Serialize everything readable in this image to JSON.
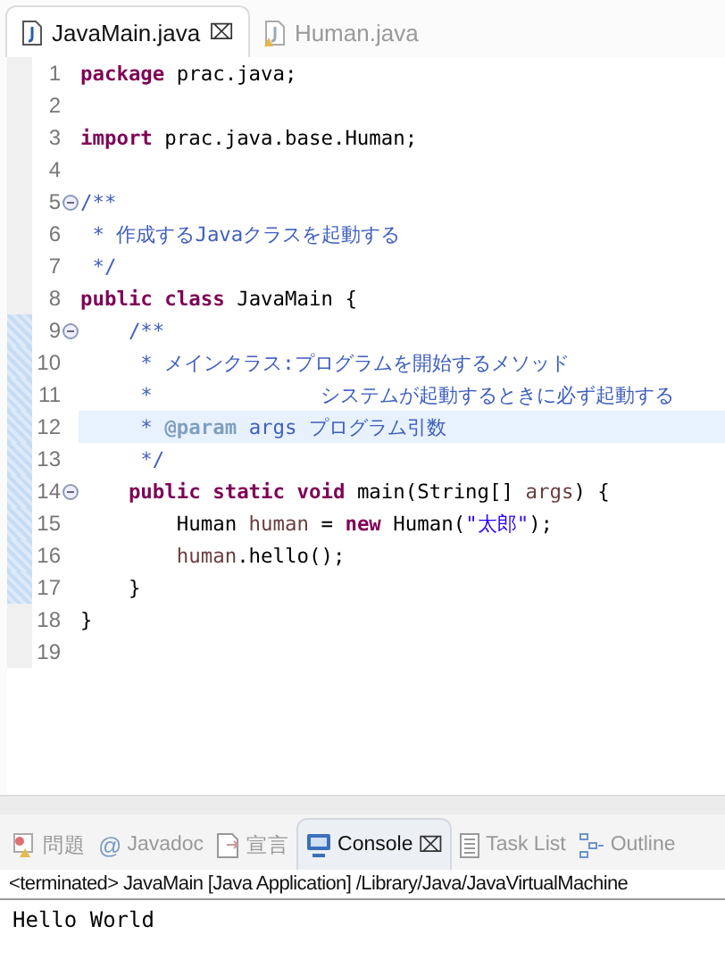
{
  "editor_tabs": [
    {
      "label": "JavaMain.java",
      "selected": true,
      "close": "⌧"
    },
    {
      "label": "Human.java",
      "selected": false
    }
  ],
  "code_lines": [
    {
      "number": "1",
      "fold": false,
      "current": false,
      "changed": false,
      "segments": [
        {
          "kind": "keyword",
          "text": "package"
        },
        {
          "kind": "plain",
          "text": " prac.java;"
        }
      ]
    },
    {
      "number": "2",
      "fold": false,
      "current": false,
      "changed": false
    },
    {
      "number": "3",
      "fold": false,
      "current": false,
      "changed": false,
      "segments": [
        {
          "kind": "keyword",
          "text": "import"
        },
        {
          "kind": "plain",
          "text": " prac.java.base.Human;"
        }
      ]
    },
    {
      "number": "4",
      "fold": false,
      "current": false,
      "changed": false
    },
    {
      "number": "5",
      "fold": true,
      "current": false,
      "changed": false,
      "segments": [
        {
          "kind": "comment",
          "text": "/**"
        }
      ]
    },
    {
      "number": "6",
      "fold": false,
      "current": false,
      "changed": false,
      "segments": [
        {
          "kind": "comment",
          "text": " * 作成するJavaクラスを起動する"
        }
      ]
    },
    {
      "number": "7",
      "fold": false,
      "current": false,
      "changed": false,
      "segments": [
        {
          "kind": "comment",
          "text": " */"
        }
      ]
    },
    {
      "number": "8",
      "fold": false,
      "current": false,
      "changed": false,
      "segments": [
        {
          "kind": "keyword",
          "text": "public "
        },
        {
          "kind": "keyword",
          "text": "class"
        },
        {
          "kind": "plain",
          "text": " JavaMain {"
        }
      ]
    },
    {
      "number": "9",
      "fold": true,
      "current": false,
      "changed": true,
      "segments": [
        {
          "kind": "comment",
          "text": "    /**"
        }
      ]
    },
    {
      "number": "10",
      "fold": false,
      "current": false,
      "changed": true,
      "segments": [
        {
          "kind": "comment",
          "text": "     * メインクラス:プログラムを開始するメソッド"
        }
      ]
    },
    {
      "number": "11",
      "fold": false,
      "current": false,
      "changed": true,
      "segments": [
        {
          "kind": "comment",
          "text": "     *              システムが起動するときに必ず起動する"
        }
      ]
    },
    {
      "number": "12",
      "fold": false,
      "current": true,
      "changed": true,
      "segments": [
        {
          "kind": "comment",
          "text": "     * "
        },
        {
          "kind": "doctag",
          "text": "@param"
        },
        {
          "kind": "comment",
          "text": " args プログラム引数"
        }
      ]
    },
    {
      "number": "13",
      "fold": false,
      "current": false,
      "changed": true,
      "segments": [
        {
          "kind": "comment",
          "text": "     */"
        }
      ]
    },
    {
      "number": "14",
      "fold": true,
      "current": false,
      "changed": true,
      "segments": [
        {
          "kind": "keyword",
          "text": "    public "
        },
        {
          "kind": "keyword",
          "text": "static "
        },
        {
          "kind": "keyword",
          "text": "void"
        },
        {
          "kind": "plain",
          "text": " main(String[] "
        },
        {
          "kind": "variable",
          "text": "args"
        },
        {
          "kind": "plain",
          "text": ") {"
        }
      ]
    },
    {
      "number": "15",
      "fold": false,
      "current": false,
      "changed": true,
      "segments": [
        {
          "kind": "plain",
          "text": "        Human "
        },
        {
          "kind": "variable",
          "text": "human"
        },
        {
          "kind": "plain",
          "text": " = "
        },
        {
          "kind": "keyword",
          "text": "new"
        },
        {
          "kind": "plain",
          "text": " Human("
        },
        {
          "kind": "string",
          "text": "\"太郎\""
        },
        {
          "kind": "plain",
          "text": ");"
        }
      ]
    },
    {
      "number": "16",
      "fold": false,
      "current": false,
      "changed": true,
      "segments": [
        {
          "kind": "variable",
          "text": "        human"
        },
        {
          "kind": "plain",
          "text": ".hello();"
        }
      ]
    },
    {
      "number": "17",
      "fold": false,
      "current": false,
      "changed": true,
      "segments": [
        {
          "kind": "plain",
          "text": "    }"
        }
      ]
    },
    {
      "number": "18",
      "fold": false,
      "current": false,
      "changed": false,
      "segments": [
        {
          "kind": "plain",
          "text": "}"
        }
      ]
    },
    {
      "number": "19",
      "fold": false,
      "current": false,
      "changed": false
    }
  ],
  "panel_tabs": [
    {
      "kind": "problems",
      "label": "問題",
      "selected": false
    },
    {
      "kind": "javadoc",
      "label": "Javadoc",
      "selected": false,
      "icon_char": "@"
    },
    {
      "kind": "declaration",
      "label": "宣言",
      "selected": false
    },
    {
      "kind": "console",
      "label": "Console",
      "selected": true,
      "close": "⌧"
    },
    {
      "kind": "tasks",
      "label": "Task List",
      "selected": false
    },
    {
      "kind": "outline",
      "label": "Outline",
      "selected": false
    }
  ],
  "console": {
    "header": "<terminated> JavaMain [Java Application] /Library/Java/JavaVirtualMachine",
    "output": "Hello World"
  }
}
